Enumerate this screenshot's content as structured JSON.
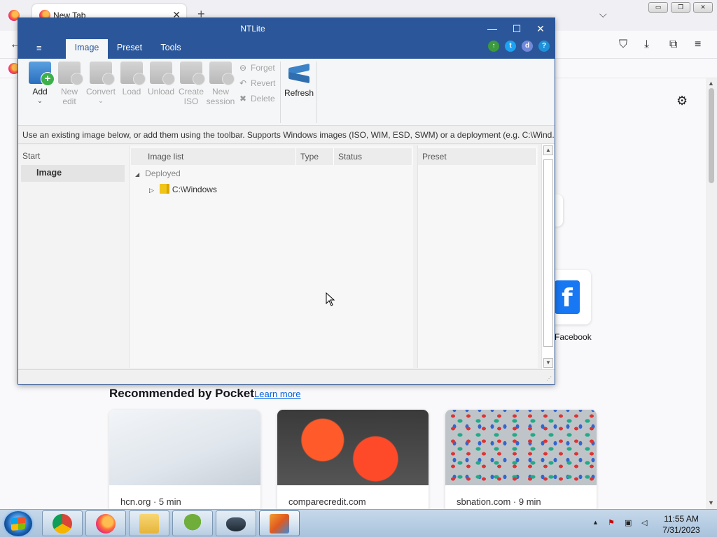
{
  "firefox": {
    "tab_title": "New Tab",
    "tab_close": "✕",
    "new_tab": "+",
    "list_all_tabs": "⌵",
    "win_minimize": "▭",
    "win_restore": "❐",
    "win_close": "✕",
    "back": "←",
    "toolbar_icons": {
      "pocket": "⛉",
      "downloads": "⤓",
      "extensions": "⧉",
      "menu": "≡"
    },
    "settings": "⚙",
    "shortcut_label": "Facebook",
    "shortcut_letter": "f",
    "pocket": {
      "heading": "Recommended by Pocket",
      "learn_more": "Learn more",
      "cards": [
        {
          "source": "hcn.org · 5 min"
        },
        {
          "source": "comparecredit.com"
        },
        {
          "source": "sbnation.com · 9 min"
        }
      ]
    }
  },
  "ntlite": {
    "title": "NTLite",
    "window_controls": {
      "minimize": "—",
      "maximize": "☐",
      "close": "✕"
    },
    "menu": "≡",
    "tabs": [
      "Image",
      "Preset",
      "Tools"
    ],
    "active_tab": "Image",
    "social": [
      "↑",
      "t",
      "d",
      "?"
    ],
    "ribbon": {
      "add": "Add",
      "add_dropdown": "⌄",
      "new_edit": [
        "New",
        "edit"
      ],
      "convert": "Convert",
      "convert_dropdown": "⌄",
      "load": "Load",
      "unload": "Unload",
      "create_iso": [
        "Create",
        "ISO"
      ],
      "new_session": [
        "New",
        "session"
      ],
      "forget": "Forget",
      "revert": "Revert",
      "delete": "Delete",
      "refresh": "Refresh"
    },
    "info": "Use an existing image below, or add them using the toolbar. Supports Windows images (ISO, WIM, ESD, SWM) or a deployment (e.g. C:\\Wind...",
    "start_panel": {
      "header": "Start",
      "item": "Image"
    },
    "columns": {
      "image_list": "Image list",
      "type": "Type",
      "status": "Status",
      "preset": "Preset"
    },
    "tree": {
      "group": "Deployed",
      "group_toggle": "◢",
      "item": "C:\\Windows",
      "item_toggle": "▷"
    },
    "scroll": {
      "up": "▲",
      "down": "▼"
    },
    "grip": "⋰"
  },
  "taskbar": {
    "apps": [
      "chrome",
      "firefox",
      "explorer",
      "tree-app",
      "boat-app",
      "ntlite"
    ],
    "active_app": "ntlite",
    "tray_expand": "▲",
    "time": "11:55 AM",
    "date": "7/31/2023"
  },
  "colors": {
    "ntlite_blue": "#2b579a",
    "firefox_bg": "#f9f9fb",
    "pocket_link": "#0061e0",
    "taskbar": "#b3cbe3"
  }
}
